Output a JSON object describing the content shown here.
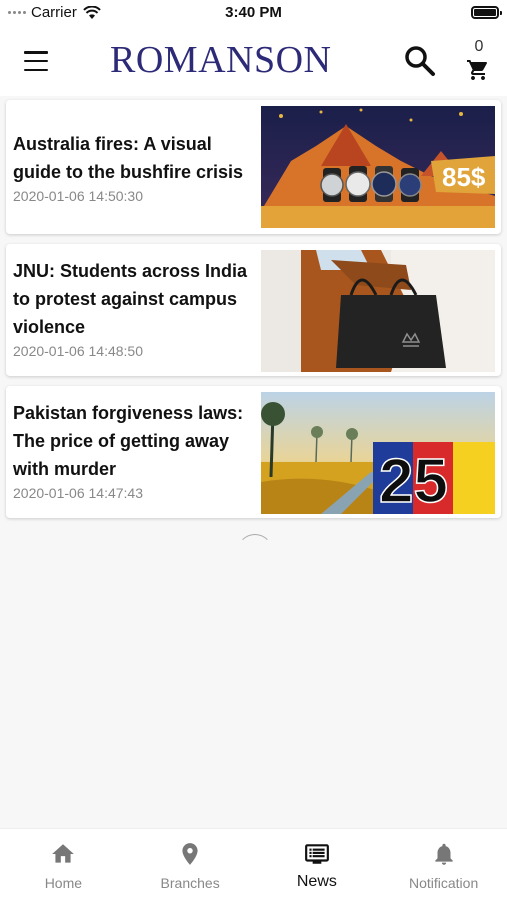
{
  "status_bar": {
    "carrier": "Carrier",
    "time": "3:40 PM"
  },
  "header": {
    "logo": "ROMANSON",
    "cart_count": "0"
  },
  "news": [
    {
      "title": "Australia fires: A visual guide to the bushfire crisis",
      "date": "2020-01-06 14:50:30",
      "image": "watches-promo-image",
      "price_label": "85$"
    },
    {
      "title": "JNU: Students across India to protest against campus violence",
      "date": "2020-01-06 14:48:50",
      "image": "handbag-image"
    },
    {
      "title": "Pakistan forgiveness laws: The price of getting away with murder",
      "date": "2020-01-06 14:47:43",
      "image": "discount-promo-image",
      "price_label": "25"
    }
  ],
  "bottom_nav": [
    {
      "label": "Home",
      "icon": "home-icon",
      "active": false
    },
    {
      "label": "Branches",
      "icon": "location-pin-icon",
      "active": false
    },
    {
      "label": "News",
      "icon": "news-icon",
      "active": true
    },
    {
      "label": "Notification",
      "icon": "bell-icon",
      "active": false
    }
  ],
  "colors": {
    "brand": "#2d2a78",
    "accent": "#111111",
    "inactive": "#888888"
  }
}
